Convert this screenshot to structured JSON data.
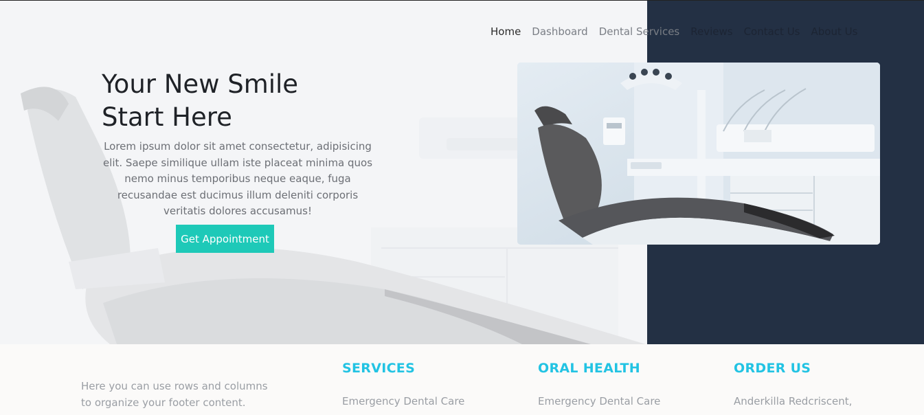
{
  "nav": {
    "items": [
      "Home",
      "Dashboard",
      "Dental Services",
      "Reviews",
      "Contact Us",
      "About Us"
    ]
  },
  "hero": {
    "title_line1": "Your New Smile",
    "title_line2": "Start Here",
    "text": "Lorem ipsum dolor sit amet consectetur, adipisicing elit. Saepe similique ullam iste placeat minima quos nemo minus temporibus neque eaque, fuga recusandae est ducimus illum deleniti corporis veritatis dolores accusamus!",
    "cta_label": "Get Appointment"
  },
  "footer": {
    "about": "Here you can use rows and columns to organize your footer content.",
    "columns": [
      {
        "heading": "SERVICES",
        "item": "Emergency Dental Care"
      },
      {
        "heading": "ORAL HEALTH",
        "item": "Emergency Dental Care"
      },
      {
        "heading": "ORDER US",
        "item": "Anderkilla Redcriscent,"
      }
    ]
  },
  "colors": {
    "accent": "#1ec9b8",
    "heading_blue": "#22c3e3",
    "dark_panel": "#233044"
  }
}
